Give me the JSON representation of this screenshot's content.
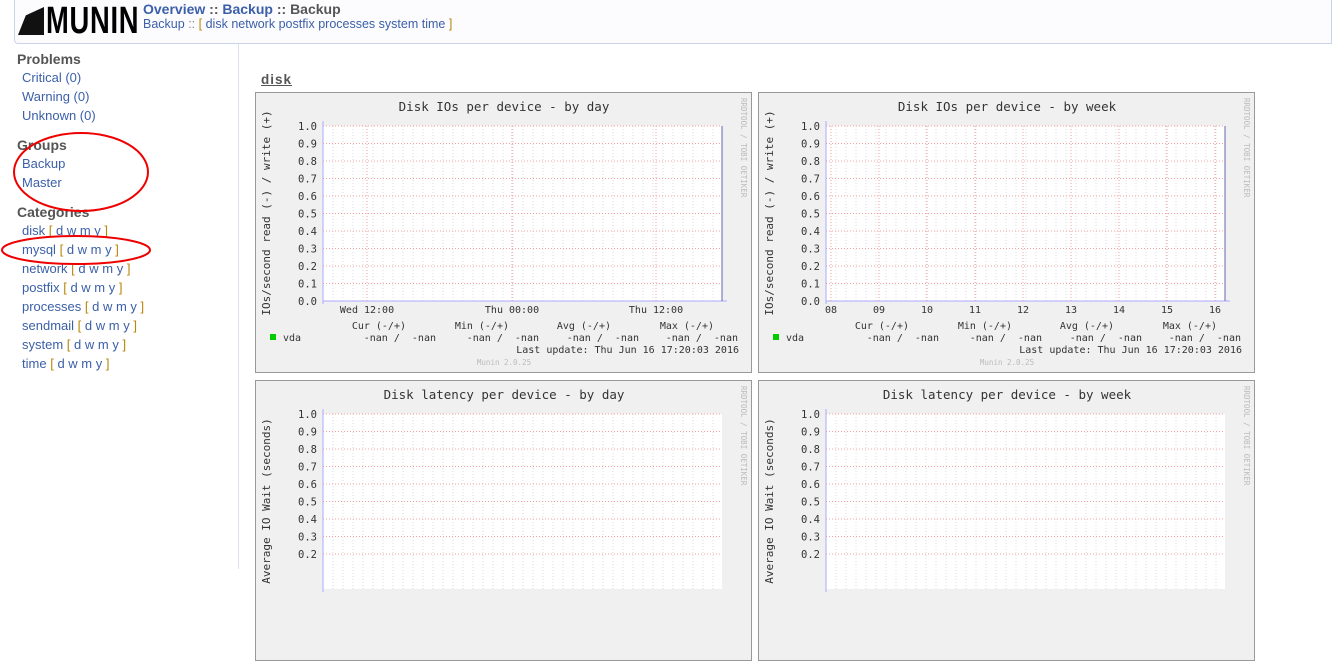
{
  "header": {
    "logo": "MUNIN",
    "breadcrumb": [
      "Overview",
      "Backup",
      "Backup"
    ],
    "sub_group": "Backup",
    "sub_links": [
      "disk",
      "network",
      "postfix",
      "processes",
      "system",
      "time"
    ]
  },
  "sidebar": {
    "problems_title": "Problems",
    "problems": [
      "Critical (0)",
      "Warning (0)",
      "Unknown (0)"
    ],
    "groups_title": "Groups",
    "groups": [
      "Backup",
      "Master"
    ],
    "categories_title": "Categories",
    "categories": [
      "disk",
      "mysql",
      "network",
      "postfix",
      "processes",
      "sendmail",
      "system",
      "time"
    ],
    "periods": "d w m y"
  },
  "section_title": "disk",
  "colors": {
    "link": "#3b5fa8",
    "legend_vda": "#00cc00",
    "grid": "#ff9999"
  },
  "graphs": [
    {
      "title": "Disk IOs per device - by day",
      "ylabel": "IOs/second read (-) / write (+)",
      "yticks": [
        "1.0",
        "0.9",
        "0.8",
        "0.7",
        "0.6",
        "0.5",
        "0.4",
        "0.3",
        "0.2",
        "0.1",
        "0.0"
      ],
      "xticks": [
        "Wed 12:00",
        "Thu 00:00",
        "Thu 12:00"
      ],
      "legend": {
        "headers": [
          "Cur (-/+)",
          "Min (-/+)",
          "Avg (-/+)",
          "Max (-/+)"
        ],
        "series": "vda",
        "values": [
          "-nan /  -nan",
          "-nan /  -nan",
          "-nan /  -nan",
          "-nan /  -nan"
        ],
        "last_update": "Last update:  Thu Jun 16 17:20:03 2016",
        "footer": "Munin 2.0.25"
      },
      "side": "RRDTOOL / TOBI OETIKER"
    },
    {
      "title": "Disk IOs per device - by week",
      "ylabel": "IOs/second read (-) / write (+)",
      "yticks": [
        "1.0",
        "0.9",
        "0.8",
        "0.7",
        "0.6",
        "0.5",
        "0.4",
        "0.3",
        "0.2",
        "0.1",
        "0.0"
      ],
      "xticks": [
        "08",
        "09",
        "10",
        "11",
        "12",
        "13",
        "14",
        "15",
        "16"
      ],
      "legend": {
        "headers": [
          "Cur (-/+)",
          "Min (-/+)",
          "Avg (-/+)",
          "Max (-/+)"
        ],
        "series": "vda",
        "values": [
          "-nan /  -nan",
          "-nan /  -nan",
          "-nan /  -nan",
          "-nan /  -nan"
        ],
        "last_update": "Last update:  Thu Jun 16 17:20:03 2016",
        "footer": "Munin 2.0.25"
      },
      "side": "RRDTOOL / TOBI OETIKER"
    },
    {
      "title": "Disk latency per device - by day",
      "ylabel": "Average IO Wait (seconds)",
      "yticks": [
        "1.0",
        "0.9",
        "0.8",
        "0.7",
        "0.6",
        "0.5",
        "0.4",
        "0.3",
        "0.2"
      ],
      "xticks": [],
      "side": "RRDTOOL / TOBI OETIKER"
    },
    {
      "title": "Disk latency per device - by week",
      "ylabel": "Average IO Wait (seconds)",
      "yticks": [
        "1.0",
        "0.9",
        "0.8",
        "0.7",
        "0.6",
        "0.5",
        "0.4",
        "0.3",
        "0.2"
      ],
      "xticks": [],
      "side": "RRDTOOL / TOBI OETIKER"
    }
  ]
}
